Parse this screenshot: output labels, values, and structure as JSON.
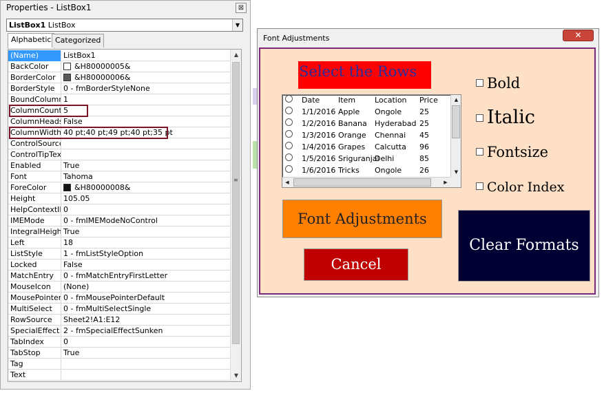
{
  "properties": {
    "title": "Properties - ListBox1",
    "close_label": "⊠",
    "object_name": "ListBox1",
    "object_type": "ListBox",
    "tabs": [
      "Alphabetic",
      "Categorized"
    ],
    "rows": [
      {
        "name": "(Name)",
        "value": "ListBox1"
      },
      {
        "name": "BackColor",
        "value": "&H80000005&",
        "swatch": "#ffffff"
      },
      {
        "name": "BorderColor",
        "value": "&H80000006&",
        "swatch": "#5a5a5a"
      },
      {
        "name": "BorderStyle",
        "value": "0 - fmBorderStyleNone"
      },
      {
        "name": "BoundColumn",
        "value": "1"
      },
      {
        "name": "ColumnCount",
        "value": "5"
      },
      {
        "name": "ColumnHeads",
        "value": "False"
      },
      {
        "name": "ColumnWidths",
        "value": "40 pt;40 pt;49 pt;40 pt;35 pt"
      },
      {
        "name": "ControlSource",
        "value": ""
      },
      {
        "name": "ControlTipText",
        "value": ""
      },
      {
        "name": "Enabled",
        "value": "True"
      },
      {
        "name": "Font",
        "value": "Tahoma"
      },
      {
        "name": "ForeColor",
        "value": "&H80000008&",
        "swatch": "#111111"
      },
      {
        "name": "Height",
        "value": "105.05"
      },
      {
        "name": "HelpContextID",
        "value": "0"
      },
      {
        "name": "IMEMode",
        "value": "0 - fmIMEModeNoControl"
      },
      {
        "name": "IntegralHeight",
        "value": "True"
      },
      {
        "name": "Left",
        "value": "18"
      },
      {
        "name": "ListStyle",
        "value": "1 - fmListStyleOption"
      },
      {
        "name": "Locked",
        "value": "False"
      },
      {
        "name": "MatchEntry",
        "value": "0 - fmMatchEntryFirstLetter"
      },
      {
        "name": "MouseIcon",
        "value": "(None)"
      },
      {
        "name": "MousePointer",
        "value": "0 - fmMousePointerDefault"
      },
      {
        "name": "MultiSelect",
        "value": "0 - fmMultiSelectSingle"
      },
      {
        "name": "RowSource",
        "value": "Sheet2!A1:E12"
      },
      {
        "name": "SpecialEffect",
        "value": "2 - fmSpecialEffectSunken"
      },
      {
        "name": "TabIndex",
        "value": "0"
      },
      {
        "name": "TabStop",
        "value": "True"
      },
      {
        "name": "Tag",
        "value": ""
      },
      {
        "name": "Text",
        "value": ""
      }
    ]
  },
  "dialog": {
    "title": "Font Adjustments",
    "close_label": "✕",
    "select_rows_label": "Select the Rows",
    "listbox": {
      "headers": [
        "Date",
        "Item",
        "Location",
        "Price"
      ],
      "rows": [
        [
          "1/1/2016",
          "Apple",
          "Ongole",
          "25"
        ],
        [
          "1/2/2016",
          "Banana",
          "Hyderabad",
          "25"
        ],
        [
          "1/3/2016",
          "Orange",
          "Chennai",
          "45"
        ],
        [
          "1/4/2016",
          "Grapes",
          "Calcutta",
          "96"
        ],
        [
          "1/5/2016",
          "Sriguranjal",
          "Delhi",
          "85"
        ],
        [
          "1/6/2016",
          "Tricks",
          "Ongole",
          "26"
        ]
      ]
    },
    "checkboxes": {
      "bold": "Bold",
      "italic": "Italic",
      "fontsize": "Fontsize",
      "color_index": "Color Index"
    },
    "buttons": {
      "font_adjustments": "Font Adjustments",
      "cancel": "Cancel",
      "clear_formats": "Clear Formats"
    }
  },
  "colors": {
    "dialog_background": "#fde0c5",
    "select_rows_bg": "#ff0000",
    "font_btn_bg": "#ff7f00",
    "cancel_btn_bg": "#c00000",
    "clear_btn_bg": "#000033",
    "highlight_border": "#7a1326"
  }
}
